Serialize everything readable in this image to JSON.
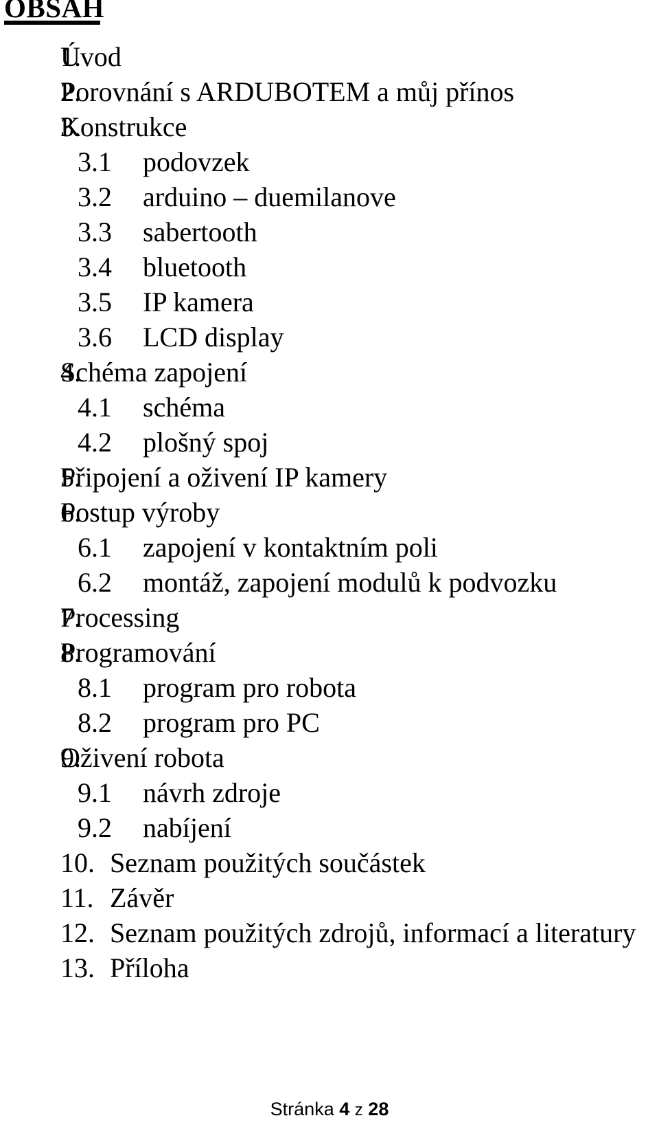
{
  "document": {
    "heading": "OBSAH"
  },
  "toc": {
    "items": [
      {
        "number": "1.",
        "label": "Úvod",
        "level": 1
      },
      {
        "number": "2.",
        "label": "Porovnání s ARDUBOTEM a můj přínos",
        "level": 1
      },
      {
        "number": "3.",
        "label": "Konstrukce",
        "level": 1
      },
      {
        "number": "3.1",
        "label": "podovzek",
        "level": 2
      },
      {
        "number": "3.2",
        "label": "arduino – duemilanove",
        "level": 2
      },
      {
        "number": "3.3",
        "label": "sabertooth",
        "level": 2
      },
      {
        "number": "3.4",
        "label": "bluetooth",
        "level": 2
      },
      {
        "number": "3.5",
        "label": "IP kamera",
        "level": 2
      },
      {
        "number": "3.6",
        "label": "LCD display",
        "level": 2
      },
      {
        "number": "4.",
        "label": "Schéma zapojení",
        "level": 1
      },
      {
        "number": "4.1",
        "label": "schéma",
        "level": 2
      },
      {
        "number": "4.2",
        "label": "plošný spoj",
        "level": 2
      },
      {
        "number": "5.",
        "label": "Připojení a oživení IP kamery",
        "level": 1
      },
      {
        "number": "6.",
        "label": "Postup výroby",
        "level": 1
      },
      {
        "number": "6.1",
        "label": "zapojení v kontaktním poli",
        "level": 2
      },
      {
        "number": "6.2",
        "label": "montáž, zapojení modulů k podvozku",
        "level": 2
      },
      {
        "number": "7.",
        "label": "Processing",
        "level": 1
      },
      {
        "number": "8.",
        "label": "Programování",
        "level": 1
      },
      {
        "number": "8.1",
        "label": "program pro robota",
        "level": 2
      },
      {
        "number": "8.2",
        "label": "program pro PC",
        "level": 2
      },
      {
        "number": "9.",
        "label": "Oživení robota",
        "level": 1
      },
      {
        "number": "9.1",
        "label": "návrh zdroje",
        "level": 2
      },
      {
        "number": "9.2",
        "label": "nabíjení",
        "level": 2
      },
      {
        "number": "10.",
        "label": "Seznam použitých součástek",
        "level": 1
      },
      {
        "number": "11.",
        "label": "Závěr",
        "level": 1
      },
      {
        "number": "12.",
        "label": "Seznam použitých zdrojů, informací a literatury",
        "level": 1
      },
      {
        "number": "13.",
        "label": "Příloha",
        "level": 1
      }
    ]
  },
  "footer": {
    "prefix": "Stránka",
    "current_page": "4",
    "separator": "z",
    "total_pages": "28"
  }
}
